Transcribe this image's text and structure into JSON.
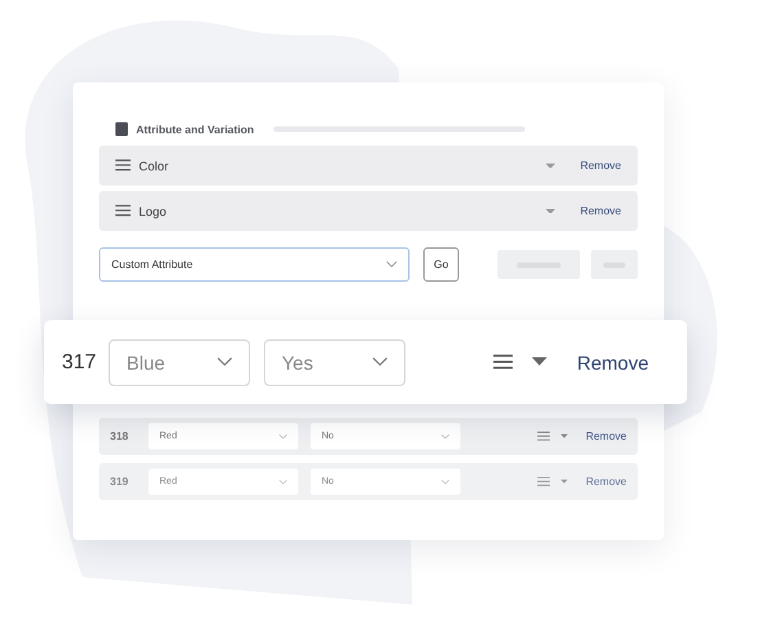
{
  "section": {
    "title": "Attribute and Variation"
  },
  "attributes": [
    {
      "name": "Color",
      "action": "Remove"
    },
    {
      "name": "Logo",
      "action": "Remove"
    }
  ],
  "custom": {
    "value": "Custom Attribute",
    "button": "Go"
  },
  "featured_variation": {
    "id": "317",
    "option_1": "Blue",
    "option_2": "Yes",
    "action": "Remove"
  },
  "variations": [
    {
      "id": "318",
      "option_1": "Red",
      "option_2": "No",
      "action": "Remove"
    },
    {
      "id": "319",
      "option_1": "Red",
      "option_2": "No",
      "action": "Remove"
    }
  ]
}
